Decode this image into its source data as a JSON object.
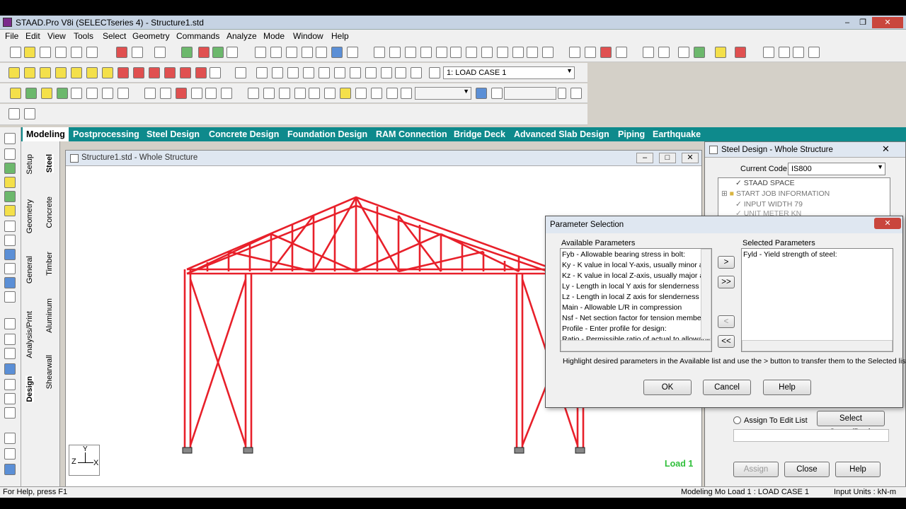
{
  "title": "STAAD.Pro V8i (SELECTseries 4) - Structure1.std",
  "menu": [
    "File",
    "Edit",
    "View",
    "Tools",
    "Select",
    "Geometry",
    "Commands",
    "Analyze",
    "Mode",
    "Window",
    "Help"
  ],
  "load_case_combo": "1: LOAD CASE 1",
  "tabs": [
    "Modeling",
    "Postprocessing",
    "Steel Design",
    "Concrete Design",
    "Foundation Design",
    "RAM Connection",
    "Bridge Deck",
    "Advanced Slab Design",
    "Piping",
    "Earthquake"
  ],
  "vtabs_left": [
    "Setup",
    "Geometry",
    "General",
    "Analysis/Print",
    "Design"
  ],
  "vtabs_right": [
    "Steel",
    "Concrete",
    "Timber",
    "Aluminum",
    "Shearwall"
  ],
  "structure_window": {
    "title": "Structure1.std - Whole Structure",
    "load_label": "Load 1",
    "axis_z": "Z",
    "axis_x": "X",
    "axis_y": "Y"
  },
  "steel_design": {
    "title": "Steel Design - Whole Structure",
    "current_code_label": "Current Code:",
    "current_code": "IS800",
    "tree": [
      "STAAD SPACE",
      "START JOB INFORMATION",
      "INPUT WIDTH 79",
      "UNIT METER KN"
    ],
    "assign_edit_list": "Assign To Edit List",
    "select_group_deck": "Select Group/Deck",
    "assign": "Assign",
    "close": "Close",
    "help": "Help"
  },
  "param_dialog": {
    "title": "Parameter Selection",
    "available_label": "Available Parameters",
    "selected_label": "Selected Parameters",
    "available": [
      "Fyb - Allowable bearing stress in bolt:",
      "Ky - K value in local Y-axis, usually minor axis",
      "Kz - K value in local Z-axis, usually major axis",
      "Ly - Length in local Y axis for slenderness va",
      "Lz - Length in local Z axis for slenderness va",
      "Main - Allowable L/R in compression",
      "Nsf - Net section factor for tension members:",
      "Profile - Enter profile for design:",
      "Ratio - Permissible ratio of actual to allowable"
    ],
    "selected": [
      "Fyld - Yield strength of steel:"
    ],
    "btn_add": ">",
    "btn_add_all": ">>",
    "btn_remove": "<",
    "btn_remove_all": "<<",
    "hint": "Highlight desired parameters in the Available list and use the > button to transfer them to the Selected list.",
    "ok": "OK",
    "cancel": "Cancel",
    "help": "Help"
  },
  "status": {
    "left": "For Help, press F1",
    "mid": "Modeling Mo Load 1 : LOAD CASE 1",
    "right": "Input Units : kN-m"
  },
  "colors": {
    "tab_bg": "#0e8a8c",
    "frame": "#e8202a",
    "load_text": "#2fbf3a"
  }
}
